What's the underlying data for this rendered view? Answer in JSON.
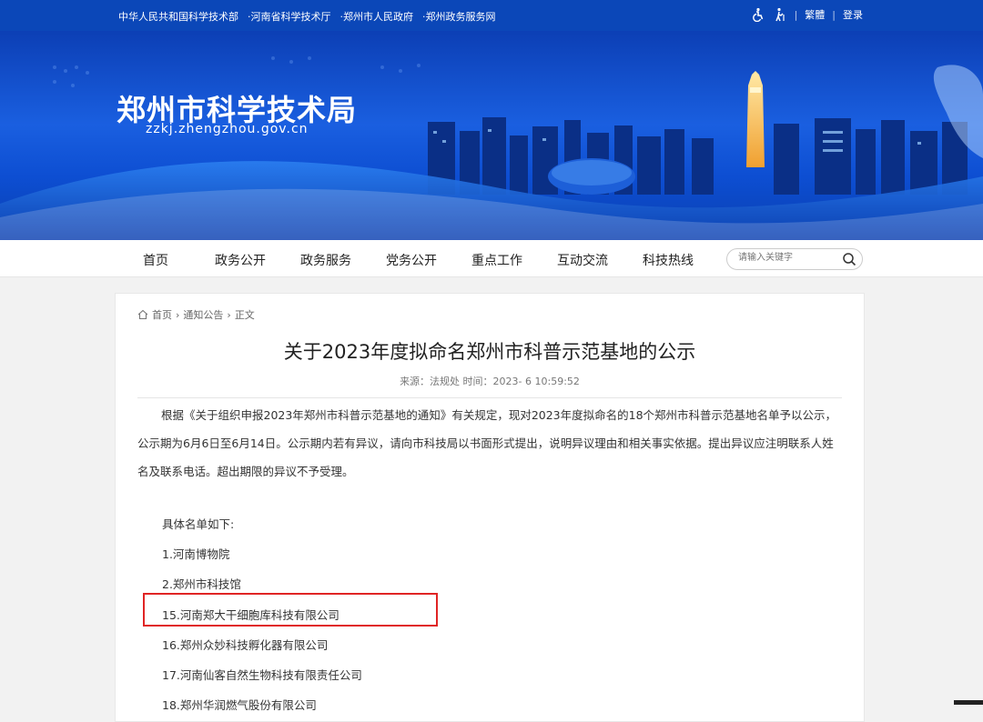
{
  "topbar": {
    "links": [
      "中华人民共和国科学技术部",
      "·河南省科学技术厅",
      "·郑州市人民政府",
      "·郑州政务服务网"
    ],
    "traditional": "繁體",
    "login": "登录"
  },
  "banner": {
    "title": "郑州市科学技术局",
    "domain": "zzkj.zhengzhou.gov.cn"
  },
  "nav": {
    "items": [
      "首页",
      "政务公开",
      "政务服务",
      "党务公开",
      "重点工作",
      "互动交流",
      "科技热线"
    ],
    "search_placeholder": "请输入关键字"
  },
  "breadcrumb": {
    "home": "首页",
    "section": "通知公告",
    "current": "正文"
  },
  "article": {
    "title": "关于2023年度拟命名郑州市科普示范基地的公示",
    "meta": "来源：法规处  时间：2023-   6 10:59:52",
    "paragraph": "根据《关于组织申报2023年郑州市科普示范基地的通知》有关规定，现对2023年度拟命名的18个郑州市科普示范基地名单予以公示，公示期为6月6日至6月14日。公示期内若有异议，请向市科技局以书面形式提出，说明异议理由和相关事实依据。提出异议应注明联系人姓名及联系电话。超出期限的异议不予受理。",
    "list_intro": "具体名单如下:",
    "items": [
      "1.河南博物院",
      "2.郑州市科技馆",
      "15.河南郑大干细胞库科技有限公司",
      "16.郑州众妙科技孵化器有限公司",
      "17.河南仙客自然生物科技有限责任公司",
      "18.郑州华润燃气股份有限公司"
    ]
  },
  "colors": {
    "topbar": "#0b47b8",
    "highlight": "#e02424"
  }
}
